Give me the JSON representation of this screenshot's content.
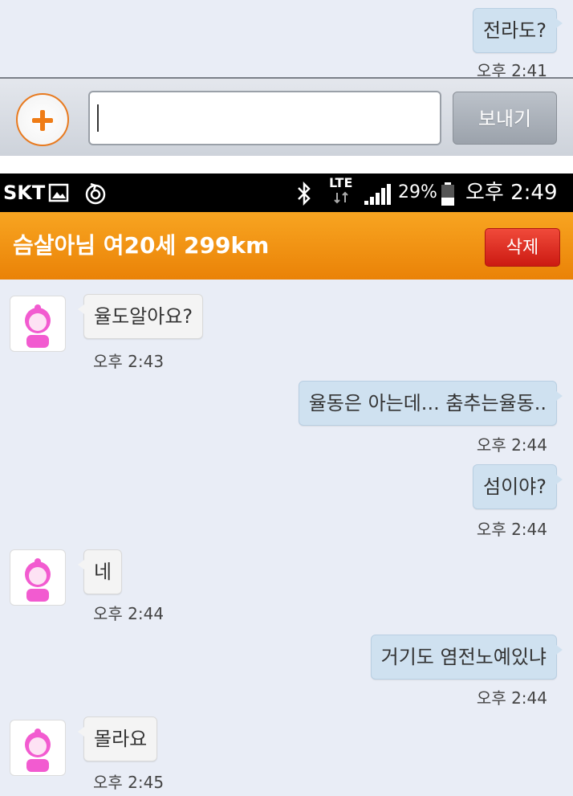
{
  "top_fragment": {
    "last_message": {
      "text": "전라도?",
      "time": "오후 2:41"
    }
  },
  "input_bar": {
    "message_value": "",
    "send_label": "보내기"
  },
  "status_bar": {
    "carrier": "SKT",
    "network": "LTE",
    "battery": "29%",
    "clock": "오후 2:49"
  },
  "header": {
    "title": "슴살아님 여20세 299km",
    "delete_label": "삭제"
  },
  "messages": [
    {
      "direction": "in",
      "text": "율도알아요?",
      "time": "오후 2:43"
    },
    {
      "direction": "out",
      "text": "율동은 아는데... 춤추는율동..",
      "time": "오후 2:44"
    },
    {
      "direction": "out",
      "text": "섬이야?",
      "time": "오후 2:44"
    },
    {
      "direction": "in",
      "text": "네",
      "time": "오후 2:44"
    },
    {
      "direction": "out",
      "text": "거기도 염전노예있냐",
      "time": "오후 2:44"
    },
    {
      "direction": "in",
      "text": "몰라요",
      "time": "오후 2:45"
    }
  ],
  "colors": {
    "chat_background": "#e9edf6",
    "outgoing_bubble": "#cfe1f0",
    "incoming_bubble": "#f4f4f4",
    "header_orange": "#f29a12",
    "delete_red": "#e0261c",
    "plus_orange": "#ef7c16"
  }
}
